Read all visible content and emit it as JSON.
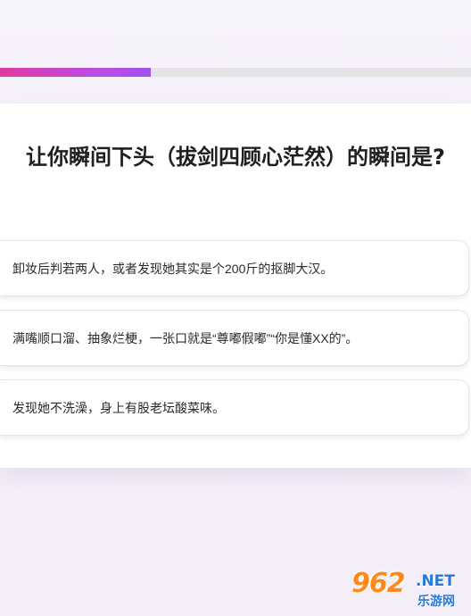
{
  "progress": {
    "fraction": 0.32,
    "fill_color": "#c347d6",
    "track_color": "#e4e4e6"
  },
  "question": {
    "text": "让你瞬间下头（拔剑四顾心茫然）的瞬间是?"
  },
  "options": [
    {
      "label": "卸妆后判若两人，或者发现她其实是个200斤的抠脚大汉。"
    },
    {
      "label": "满嘴顺口溜、抽象烂梗，一张口就是“尊嘟假嘟”“你是懂XX的”。"
    },
    {
      "label": "发现她不洗澡，身上有股老坛酸菜味。"
    }
  ],
  "watermark": {
    "number": "962",
    "domain": ".NET",
    "subtitle": "乐游网"
  }
}
